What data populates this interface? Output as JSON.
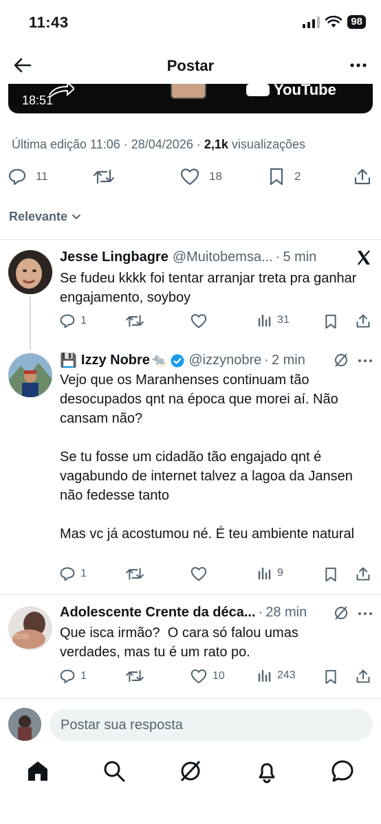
{
  "status": {
    "time": "11:43",
    "battery": "98"
  },
  "nav": {
    "title": "Postar"
  },
  "video": {
    "timestamp": "18:51",
    "logo_text": "YouTube"
  },
  "post_meta": {
    "edited_label": "Última edição 11:06 · 28/04/2026 ·",
    "views_count": "2,1k",
    "views_label": "visualizações"
  },
  "post_actions": {
    "replies": "11",
    "likes": "18",
    "bookmarks": "2"
  },
  "sort": {
    "label": "Relevante"
  },
  "replies": [
    {
      "name": "Jesse Lingbagre",
      "handle": "@Muitobemsa...",
      "time": "5 min",
      "text": "Se fudeu kkkk foi tentar arranjar treta pra ganhar engajamento, soyboy",
      "reply_count": "1",
      "retweet_count": "",
      "like_count": "",
      "view_count": "31"
    },
    {
      "name": "Izzy Nobre",
      "name_prefix_emoji": "💾",
      "name_suffix_emoji": "🐀",
      "handle": "@izzynobre",
      "time": "2 min",
      "text": "Vejo que os Maranhenses continuam tão desocupados qnt na época que morei aí. Não cansam não?\n\nSe tu fosse um cidadão tão engajado qnt é vagabundo de internet talvez a lagoa da Jansen não fedesse tanto\n\nMas vc já acostumou né. É teu ambiente natural",
      "reply_count": "1",
      "retweet_count": "",
      "like_count": "",
      "view_count": "9"
    },
    {
      "name": "Adolescente Crente da déca...",
      "handle": "",
      "time": "28 min",
      "text": "Que isca irmão?  O cara só falou umas verdades, mas tu é um rato po.",
      "reply_count": "1",
      "retweet_count": "",
      "like_count": "10",
      "view_count": "243"
    }
  ],
  "compose": {
    "placeholder": "Postar sua resposta"
  },
  "colors": {
    "text": "#0f1419",
    "muted": "#536471",
    "verified": "#1d9bf0",
    "divider": "#e3e7ea"
  },
  "icons": [
    "back-arrow-icon",
    "more-icon",
    "reply-icon",
    "retweet-icon",
    "heart-icon",
    "bookmark-icon",
    "share-icon",
    "views-icon",
    "x-logo-icon",
    "grok-icon",
    "verified-icon",
    "home-icon",
    "search-icon",
    "notifications-icon",
    "messages-icon"
  ]
}
